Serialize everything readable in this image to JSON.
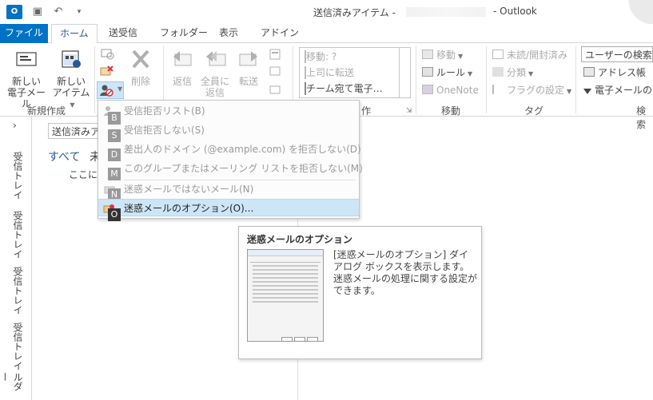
{
  "titlebar": {
    "title": "送信済みアイテム -",
    "app": "- Outlook",
    "app_icon": "O"
  },
  "tabs": [
    {
      "label": "ファイル"
    },
    {
      "label": "ホーム"
    },
    {
      "label": "送受信"
    },
    {
      "label": "フォルダー"
    },
    {
      "label": "表示"
    },
    {
      "label": "アドイン"
    }
  ],
  "ribbon": {
    "new_email": {
      "line1": "新しい",
      "line2": "電子メール"
    },
    "new_items": {
      "line1": "新しい",
      "line2": "アイテム"
    },
    "group_new": "新規作成",
    "delete": "削除",
    "reply": "返信",
    "reply_all": {
      "line1": "全員に",
      "line2": "返信"
    },
    "forward": "転送",
    "quick_steps": [
      "移動: ?",
      "上司に転送",
      "チーム宛て電子…"
    ],
    "group_quick_partial": "作",
    "move": "移動",
    "rules": "ルール",
    "onenote": "OneNote",
    "group_move": "移動",
    "unread_read": "未読/開封済み",
    "categorize": "分類",
    "follow_up": "フラグの設定",
    "group_tags": "タグ",
    "search_users": "ユーザーの検索",
    "address_book": "アドレス帳",
    "filter_email": "電子メールのフ",
    "group_find": "検索"
  },
  "folder_pane": {
    "folder_box": "送信済みアイテ",
    "filter_all": "すべて",
    "filter_unread": "未",
    "hint": "ここに表"
  },
  "rail": [
    "受信トレイ",
    "受信トレイ",
    "受信トレイ",
    "受信トレイ",
    "ルダー"
  ],
  "junk_menu": {
    "items": [
      {
        "label": "受信拒否リスト(B)",
        "key": "B"
      },
      {
        "label": "受信拒否しない(S)",
        "key": "S"
      },
      {
        "label": "差出人のドメイン (@example.com) を拒否しない(D)",
        "key": "D"
      },
      {
        "label": "このグループまたはメーリング リストを拒否しない(M)",
        "key": "M"
      },
      {
        "label": "迷惑メールではないメール(N)",
        "key": "N"
      },
      {
        "label": "迷惑メールのオプション(O)...",
        "key": "O"
      }
    ]
  },
  "tooltip": {
    "title": "迷惑メールのオプション",
    "description": "[迷惑メールのオプション] ダイアログ ボックスを表示します。迷惑メールの処理に関する設定ができます。"
  },
  "colors": {
    "accent": "#0072c6",
    "ribbon_blue": "#2b579a",
    "menu_highlight": "#cde6f7"
  },
  "icons": [
    "outlook-app-icon",
    "save-icon",
    "undo-icon",
    "new-email-icon",
    "new-items-icon",
    "ignore-icon",
    "clean-up-icon",
    "junk-icon",
    "delete-icon",
    "reply-icon",
    "reply-all-icon",
    "forward-icon",
    "move-icon",
    "rules-icon",
    "onenote-icon",
    "envelope-icon",
    "categorize-icon",
    "flag-icon",
    "address-book-icon",
    "filter-icon"
  ]
}
